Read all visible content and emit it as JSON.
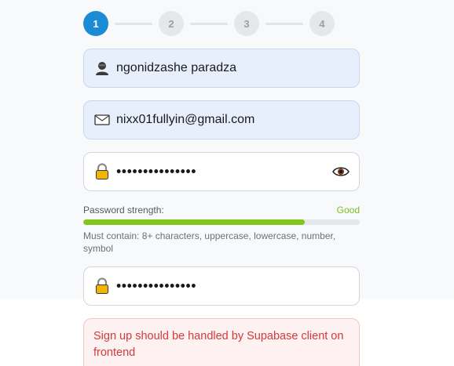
{
  "stepper": {
    "steps": [
      "1",
      "2",
      "3",
      "4"
    ],
    "active_index": 0
  },
  "form": {
    "name_value": "ngonidzashe paradza",
    "email_value": "nixx01fullyin@gmail.com",
    "password_value": "•••••••••••••••",
    "confirm_password_value": "•••••••••••••••"
  },
  "strength": {
    "label": "Password strength:",
    "value": "Good",
    "level_percent": 80,
    "color": "#80c61c",
    "hint": "Must contain: 8+ characters, uppercase, lowercase, number, symbol"
  },
  "error": {
    "message": "Sign up should be handled by Supabase client on frontend"
  },
  "icons": {
    "name_field": "person-icon",
    "email_field": "envelope-icon",
    "password_field": "lock-icon",
    "toggle_visibility": "eye-icon"
  },
  "colors": {
    "accent": "#1c8bd6",
    "error": "#d23b3b"
  }
}
